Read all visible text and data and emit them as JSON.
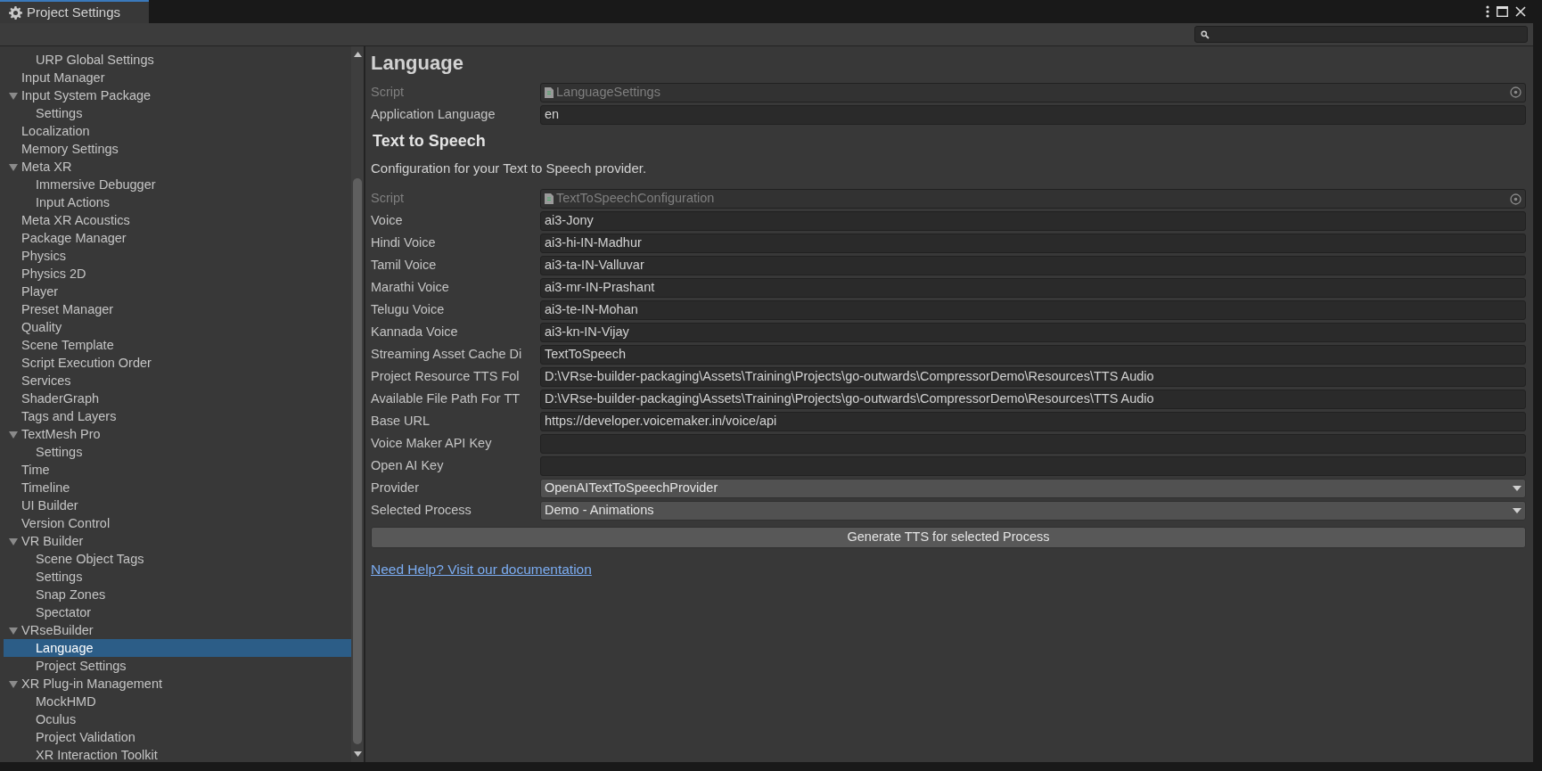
{
  "window": {
    "title": "Project Settings"
  },
  "sidebar": {
    "items": [
      {
        "children": [
          {
            "label": "URP Global Settings",
            "selected": false
          }
        ]
      },
      {
        "label": "Input Manager",
        "selected": false
      },
      {
        "label": "Input System Package",
        "selected": false,
        "expanded": true,
        "children": [
          {
            "label": "Settings",
            "selected": false
          }
        ]
      },
      {
        "label": "Localization",
        "selected": false
      },
      {
        "label": "Memory Settings",
        "selected": false
      },
      {
        "label": "Meta XR",
        "selected": false,
        "expanded": true,
        "children": [
          {
            "label": "Immersive Debugger",
            "selected": false
          },
          {
            "label": "Input Actions",
            "selected": false
          }
        ]
      },
      {
        "label": "Meta XR Acoustics",
        "selected": false
      },
      {
        "label": "Package Manager",
        "selected": false
      },
      {
        "label": "Physics",
        "selected": false
      },
      {
        "label": "Physics 2D",
        "selected": false
      },
      {
        "label": "Player",
        "selected": false
      },
      {
        "label": "Preset Manager",
        "selected": false
      },
      {
        "label": "Quality",
        "selected": false
      },
      {
        "label": "Scene Template",
        "selected": false
      },
      {
        "label": "Script Execution Order",
        "selected": false
      },
      {
        "label": "Services",
        "selected": false
      },
      {
        "label": "ShaderGraph",
        "selected": false
      },
      {
        "label": "Tags and Layers",
        "selected": false
      },
      {
        "label": "TextMesh Pro",
        "selected": false,
        "expanded": true,
        "children": [
          {
            "label": "Settings",
            "selected": false
          }
        ]
      },
      {
        "label": "Time",
        "selected": false
      },
      {
        "label": "Timeline",
        "selected": false
      },
      {
        "label": "UI Builder",
        "selected": false
      },
      {
        "label": "Version Control",
        "selected": false
      },
      {
        "label": "VR Builder",
        "selected": false,
        "expanded": true,
        "children": [
          {
            "label": "Scene Object Tags",
            "selected": false
          },
          {
            "label": "Settings",
            "selected": false
          },
          {
            "label": "Snap Zones",
            "selected": false
          },
          {
            "label": "Spectator",
            "selected": false
          }
        ]
      },
      {
        "label": "VRseBuilder",
        "selected": false,
        "expanded": true,
        "children": [
          {
            "label": "Language",
            "selected": true
          },
          {
            "label": "Project Settings",
            "selected": false
          }
        ]
      },
      {
        "label": "XR Plug-in Management",
        "selected": false,
        "expanded": true,
        "children": [
          {
            "label": "MockHMD",
            "selected": false
          },
          {
            "label": "Oculus",
            "selected": false
          },
          {
            "label": "Project Validation",
            "selected": false
          },
          {
            "label": "XR Interaction Toolkit",
            "selected": false
          }
        ]
      }
    ]
  },
  "content": {
    "title": "Language",
    "sections": [
      {
        "fields": [
          {
            "label": "Script",
            "kind": "object",
            "value": "LanguageSettings",
            "disabled": true
          },
          {
            "label": "Application Language",
            "kind": "text",
            "value": "en",
            "disabled": false
          }
        ]
      },
      {
        "title": "Text to Speech",
        "description": "Configuration for your Text to Speech provider.",
        "fields": [
          {
            "label": "Script",
            "kind": "object",
            "value": "TextToSpeechConfiguration",
            "disabled": true
          },
          {
            "label": "Voice",
            "kind": "text",
            "value": "ai3-Jony",
            "disabled": false
          },
          {
            "label": "Hindi Voice",
            "kind": "text",
            "value": "ai3-hi-IN-Madhur",
            "disabled": false
          },
          {
            "label": "Tamil Voice",
            "kind": "text",
            "value": "ai3-ta-IN-Valluvar",
            "disabled": false
          },
          {
            "label": "Marathi Voice",
            "kind": "text",
            "value": "ai3-mr-IN-Prashant",
            "disabled": false
          },
          {
            "label": "Telugu Voice",
            "kind": "text",
            "value": "ai3-te-IN-Mohan",
            "disabled": false
          },
          {
            "label": "Kannada Voice",
            "kind": "text",
            "value": "ai3-kn-IN-Vijay",
            "disabled": false
          },
          {
            "label": "Streaming Asset Cache Di",
            "kind": "text",
            "value": "TextToSpeech",
            "disabled": false
          },
          {
            "label": "Project Resource TTS Fol",
            "kind": "text",
            "value": "D:\\VRse-builder-packaging\\Assets\\Training\\Projects\\go-outwards\\CompressorDemo\\Resources\\TTS Audio",
            "disabled": false
          },
          {
            "label": "Available File Path For TT",
            "kind": "text",
            "value": "D:\\VRse-builder-packaging\\Assets\\Training\\Projects\\go-outwards\\CompressorDemo\\Resources\\TTS Audio",
            "disabled": false
          },
          {
            "label": "Base URL",
            "kind": "text",
            "value": "https://developer.voicemaker.in/voice/api",
            "disabled": false
          },
          {
            "label": "Voice Maker API Key",
            "kind": "text",
            "disabled": false
          },
          {
            "label": "Open AI Key",
            "kind": "text",
            "disabled": false
          },
          {
            "label": "Provider",
            "kind": "dropdown",
            "value": "OpenAITextToSpeechProvider",
            "disabled": false
          },
          {
            "label": "Selected Process",
            "kind": "dropdown",
            "value": "Demo - Animations",
            "disabled": false
          }
        ],
        "button": "Generate TTS for selected Process",
        "link": "Need Help? Visit our documentation"
      }
    ]
  }
}
